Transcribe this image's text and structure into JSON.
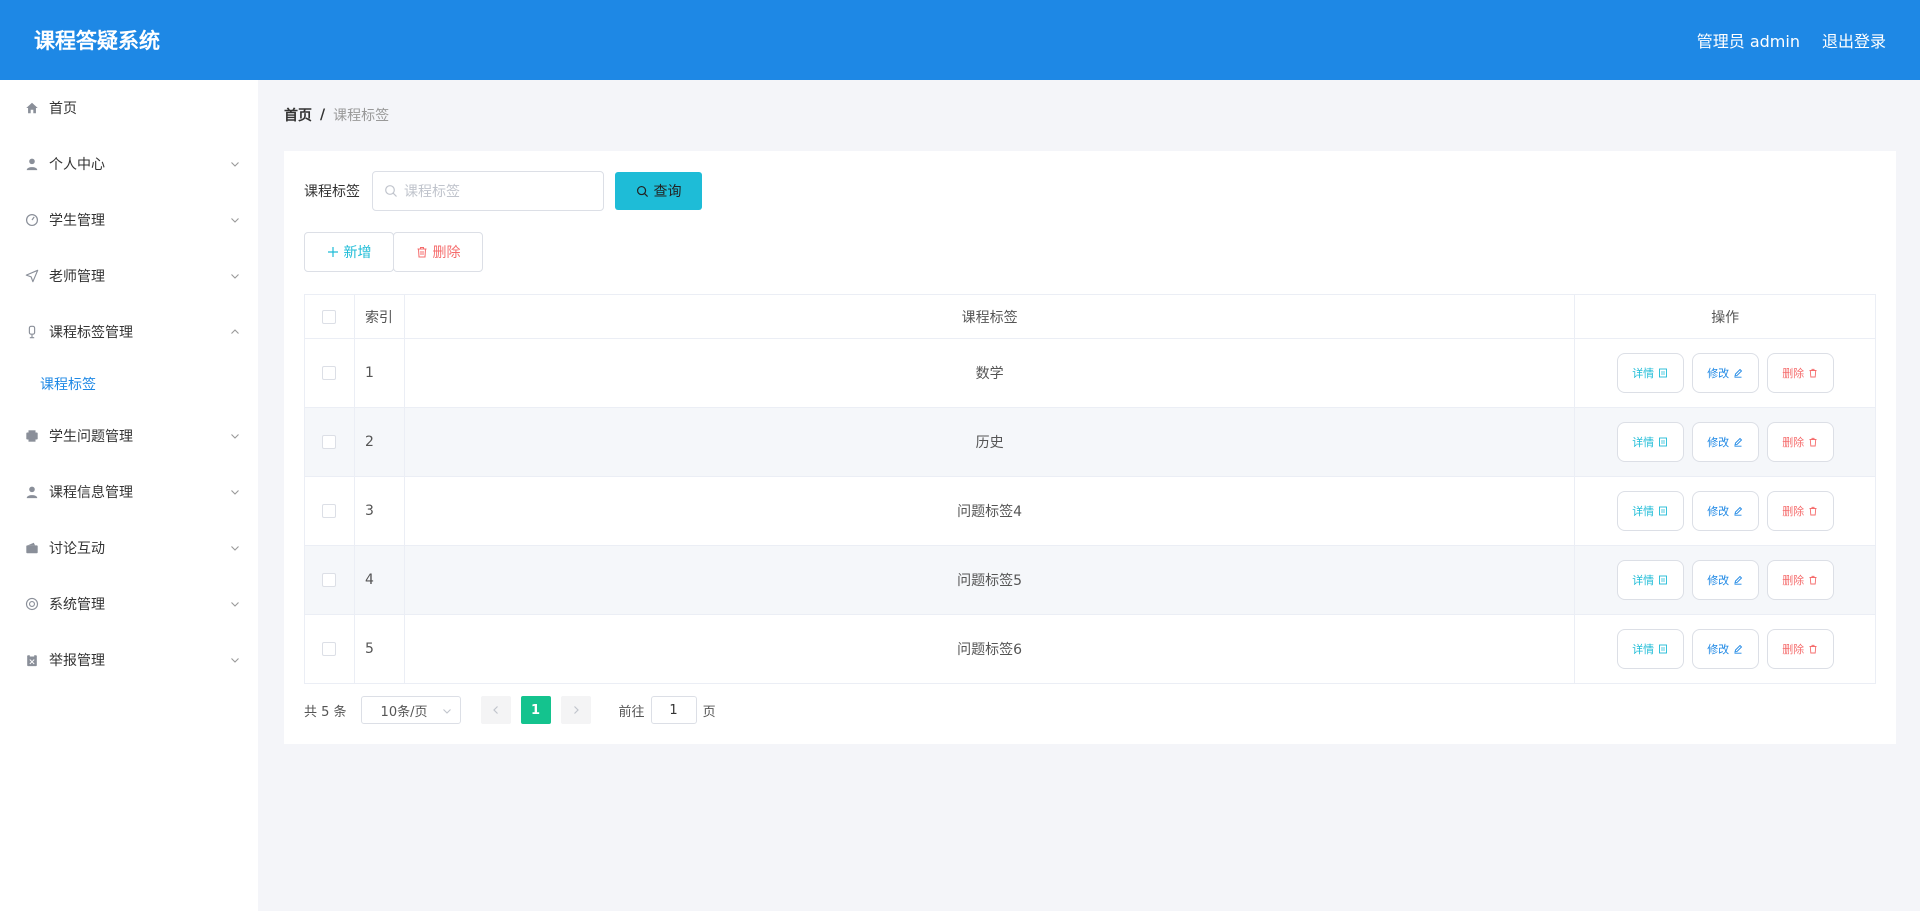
{
  "header": {
    "title": "课程答疑系统",
    "user_label": "管理员 admin",
    "logout_label": "退出登录"
  },
  "sidebar": {
    "items": [
      {
        "label": "首页",
        "icon": "home-icon"
      },
      {
        "label": "个人中心",
        "icon": "user-icon"
      },
      {
        "label": "学生管理",
        "icon": "dashboard-icon"
      },
      {
        "label": "老师管理",
        "icon": "send-icon"
      },
      {
        "label": "课程标签管理",
        "icon": "mic-icon",
        "expanded": true,
        "children": [
          {
            "label": "课程标签"
          }
        ]
      },
      {
        "label": "学生问题管理",
        "icon": "printer-icon"
      },
      {
        "label": "课程信息管理",
        "icon": "user-icon"
      },
      {
        "label": "讨论互动",
        "icon": "wallet-icon"
      },
      {
        "label": "系统管理",
        "icon": "lifebuoy-icon"
      },
      {
        "label": "举报管理",
        "icon": "clipboard-icon"
      }
    ]
  },
  "breadcrumb": {
    "home": "首页",
    "separator": "/",
    "current": "课程标签"
  },
  "search": {
    "label": "课程标签",
    "placeholder": "课程标签",
    "button_label": "查询"
  },
  "actions": {
    "add_label": "新增",
    "delete_label": "删除"
  },
  "table": {
    "columns": [
      "索引",
      "课程标签",
      "操作"
    ],
    "rows": [
      {
        "index": "1",
        "tag": "数学"
      },
      {
        "index": "2",
        "tag": "历史"
      },
      {
        "index": "3",
        "tag": "问题标签4"
      },
      {
        "index": "4",
        "tag": "问题标签5"
      },
      {
        "index": "5",
        "tag": "问题标签6"
      }
    ],
    "row_actions": {
      "detail": "详情",
      "edit": "修改",
      "remove": "删除"
    }
  },
  "pagination": {
    "total_text": "共 5 条",
    "page_size": "10条/页",
    "current_page": "1",
    "goto_label": "前往",
    "goto_value": "1",
    "page_unit": "页"
  },
  "colors": {
    "header_bg": "#1e88e5",
    "accent_cyan": "#1ebcd7",
    "danger": "#f56c6c",
    "page_active": "#14c38e"
  }
}
